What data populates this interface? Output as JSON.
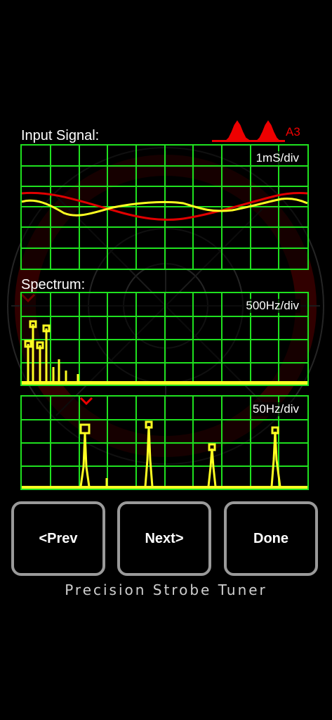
{
  "input_signal": {
    "title": "Input Signal:",
    "scale": "1mS/div",
    "note": "A3"
  },
  "spectrum": {
    "title": "Spectrum:",
    "scale": "500Hz/div"
  },
  "zoom_spectrum": {
    "scale": "50Hz/div"
  },
  "buttons": {
    "prev": "<Prev",
    "next": "Next>",
    "done": "Done"
  },
  "footer": "Precision Strobe Tuner",
  "colors": {
    "grid": "#1fe01f",
    "trace_yellow": "#ffff22",
    "trace_red": "#e00000",
    "button_border": "#9a9a9a"
  }
}
